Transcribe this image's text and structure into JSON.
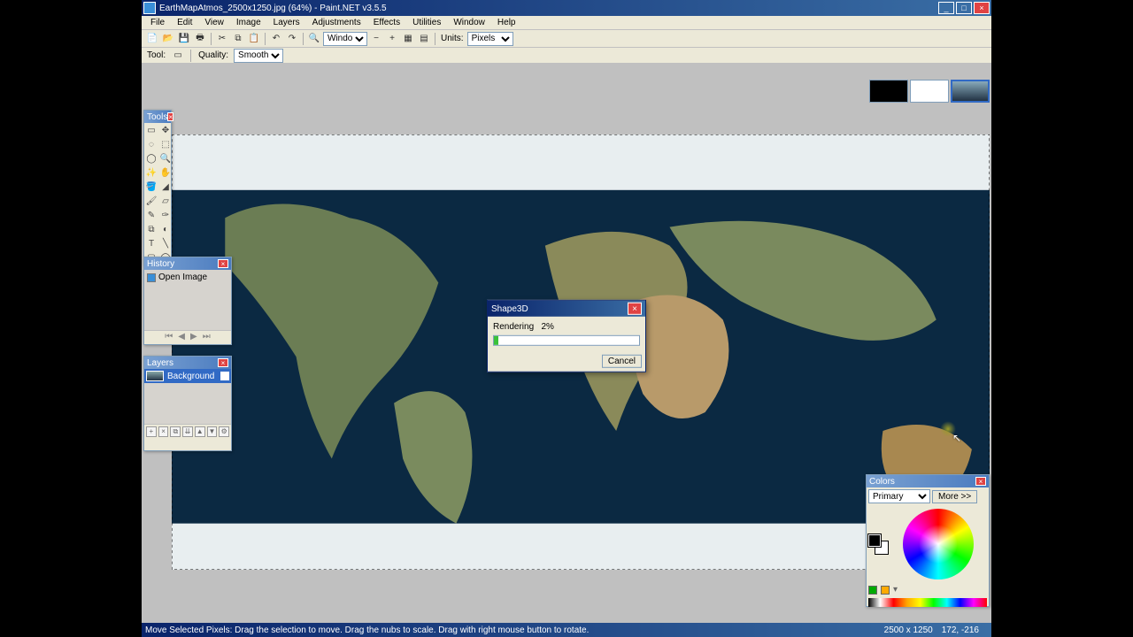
{
  "titlebar": {
    "text": "EarthMapAtmos_2500x1250.jpg (64%) - Paint.NET v3.5.5"
  },
  "menu": [
    "File",
    "Edit",
    "View",
    "Image",
    "Layers",
    "Adjustments",
    "Effects",
    "Utilities",
    "Window",
    "Help"
  ],
  "toolbar": {
    "window_label": "Window",
    "units_label": "Units:",
    "units_value": "Pixels"
  },
  "subtoolbar": {
    "tool_label": "Tool:",
    "quality_label": "Quality:",
    "quality_value": "Smooth"
  },
  "tools_panel": {
    "title": "Tools"
  },
  "history_panel": {
    "title": "History",
    "item": "Open Image"
  },
  "layers_panel": {
    "title": "Layers",
    "item": "Background"
  },
  "colors_panel": {
    "title": "Colors",
    "mode": "Primary",
    "more": "More >>"
  },
  "dialog": {
    "title": "Shape3D",
    "label": "Rendering",
    "percent": "2%",
    "cancel": "Cancel"
  },
  "status": {
    "hint": "Move Selected Pixels: Drag the selection to move. Drag the nubs to scale. Drag with right mouse button to rotate.",
    "size": "2500 x 1250",
    "pos": "172, -216"
  }
}
